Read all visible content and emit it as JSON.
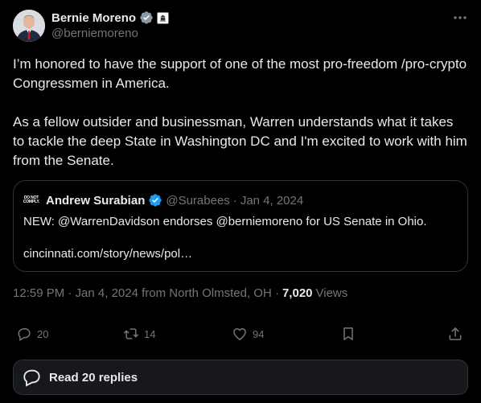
{
  "author": {
    "name": "Bernie Moreno",
    "handle": "@berniemoreno"
  },
  "post": {
    "text": "I’m honored to have the support of one of the most pro-freedom /pro-crypto Congressmen in America.\n\nAs a fellow outsider and businessman, Warren understands what it takes to tackle the deep State in Washington DC and I'm excited to work with him from the Senate.",
    "timestamp": "12:59 PM · Jan 4, 2024 from North Olmsted, OH ·",
    "views_count": "7,020",
    "views_label": "Views"
  },
  "quote": {
    "avatar_line1": "DO NOT",
    "avatar_line2": "COMPLY.",
    "name": "Andrew Surabian",
    "handle": "@Surabees",
    "separator": "·",
    "date": "Jan 4, 2024",
    "text": "NEW: @WarrenDavidson endorses @berniemoreno for US Senate in Ohio.",
    "link": "cincinnati.com/story/news/pol…"
  },
  "actions": {
    "replies": "20",
    "reposts": "14",
    "likes": "94"
  },
  "read_replies": {
    "label": "Read 20 replies"
  },
  "colors": {
    "background": "#000000",
    "text": "#e7e9ea",
    "secondary": "#71767b",
    "border": "#2f3336",
    "verified": "#1d9bf0"
  }
}
